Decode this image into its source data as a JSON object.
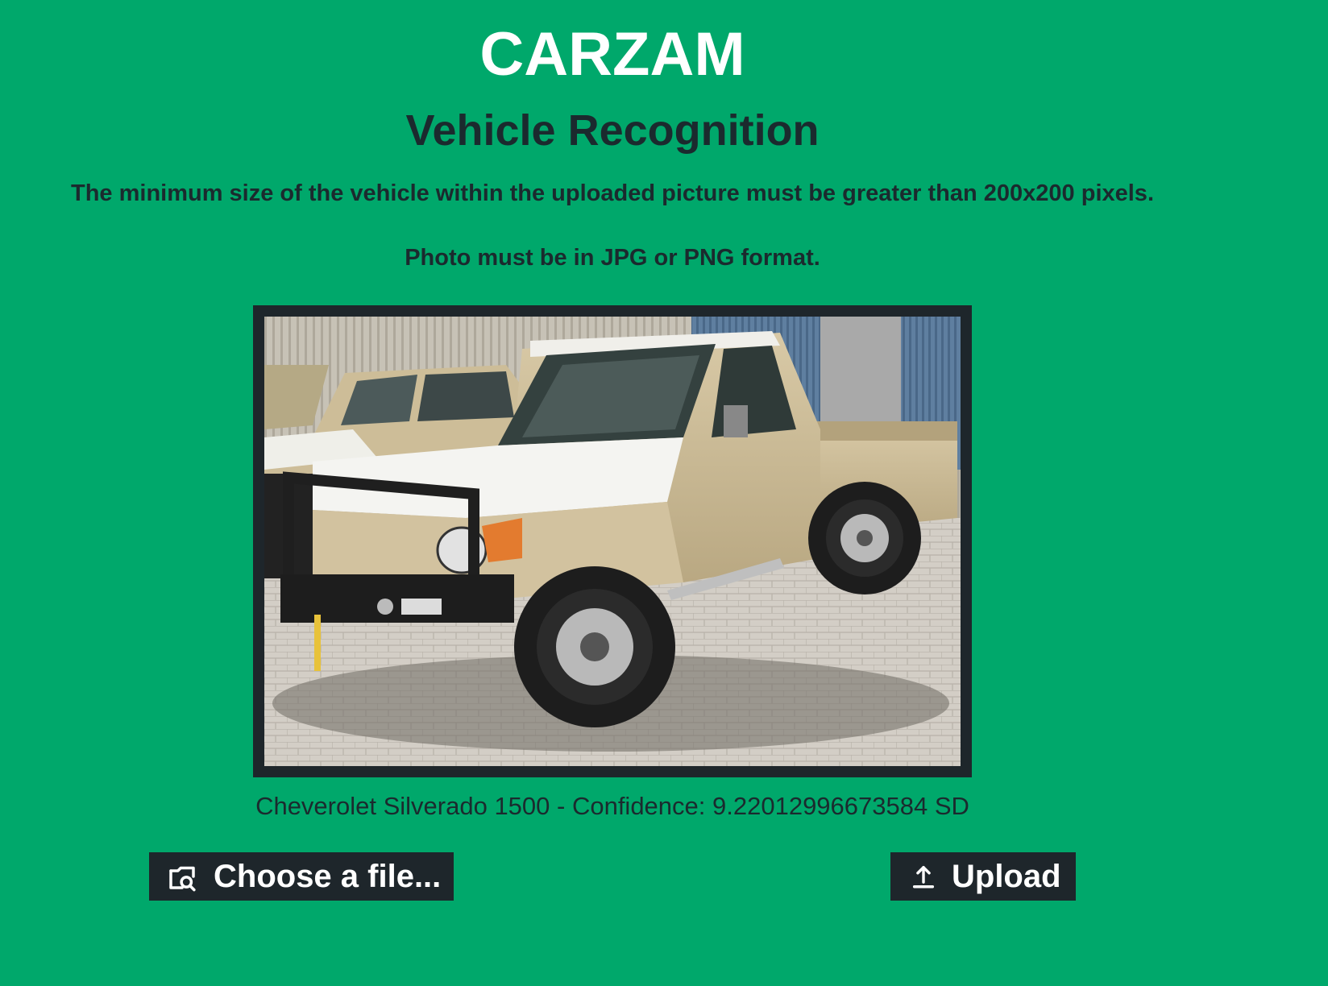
{
  "header": {
    "title": "CARZAM",
    "subtitle": "Vehicle Recognition"
  },
  "instructions": {
    "size_note": "The minimum size of the vehicle within the uploaded picture must be greater than 200x200 pixels.",
    "format_note": "Photo must be in JPG or PNG format."
  },
  "preview": {
    "alt": "uploaded vehicle photo"
  },
  "result": {
    "text": "Cheverolet Silverado 1500 - Confidence: 9.22012996673584 SD"
  },
  "actions": {
    "choose_label": "Choose a file...",
    "choose_icon": "file-search-icon",
    "upload_label": "Upload",
    "upload_icon": "upload-icon"
  },
  "colors": {
    "background": "#00a86b",
    "title": "#ffffff",
    "text": "#1b2a2e",
    "button": "#1e262b",
    "button_text": "#ffffff"
  }
}
